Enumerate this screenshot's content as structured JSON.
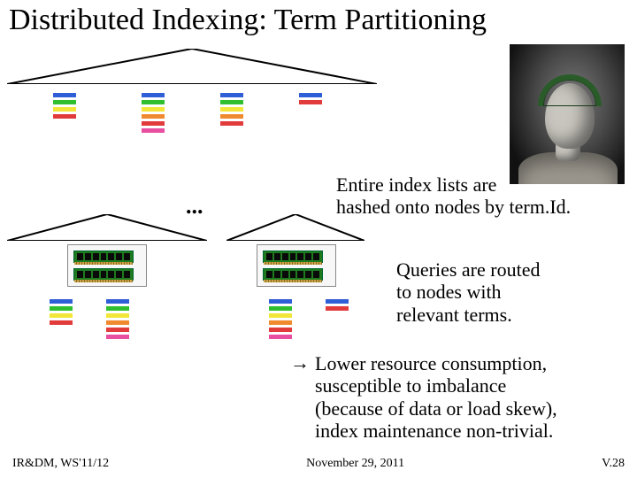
{
  "title": "Distributed Indexing: Term Partitioning",
  "ellipsis": "...",
  "text": {
    "hash": "Entire index lists are\nhashed onto nodes by term.Id.",
    "queries": "Queries are routed\nto nodes with\nrelevant terms.",
    "lower_arrow": "→",
    "lower": "Lower resource consumption,\nsusceptible to imbalance\n(because of data or load skew),\nindex maintenance non-trivial."
  },
  "footer": {
    "left": "IR&DM, WS'11/12",
    "center": "November 29, 2011",
    "right": "V.28"
  },
  "colors": {
    "blue": "#2f5fd6",
    "green": "#2fbf2f",
    "yellow": "#f2e63a",
    "orange": "#f08a2f",
    "red": "#e23b3b",
    "pink": "#e84fa0"
  },
  "barSets": {
    "top1": [
      "blue",
      "green",
      "yellow",
      "red"
    ],
    "top2": [
      "blue",
      "green",
      "yellow",
      "orange",
      "red",
      "pink"
    ],
    "top3": [
      "blue",
      "green",
      "yellow",
      "orange",
      "red"
    ],
    "top4": [
      "blue",
      "red"
    ],
    "bL1": [
      "blue",
      "green",
      "yellow",
      "red"
    ],
    "bL2": [
      "blue",
      "green",
      "yellow",
      "orange",
      "red",
      "pink"
    ],
    "bR1": [
      "blue",
      "green",
      "yellow",
      "orange",
      "red",
      "pink"
    ],
    "bR2": [
      "blue",
      "red"
    ]
  },
  "image": {
    "caesar_alt": "Bust of Julius Caesar wearing laurel wreath"
  }
}
